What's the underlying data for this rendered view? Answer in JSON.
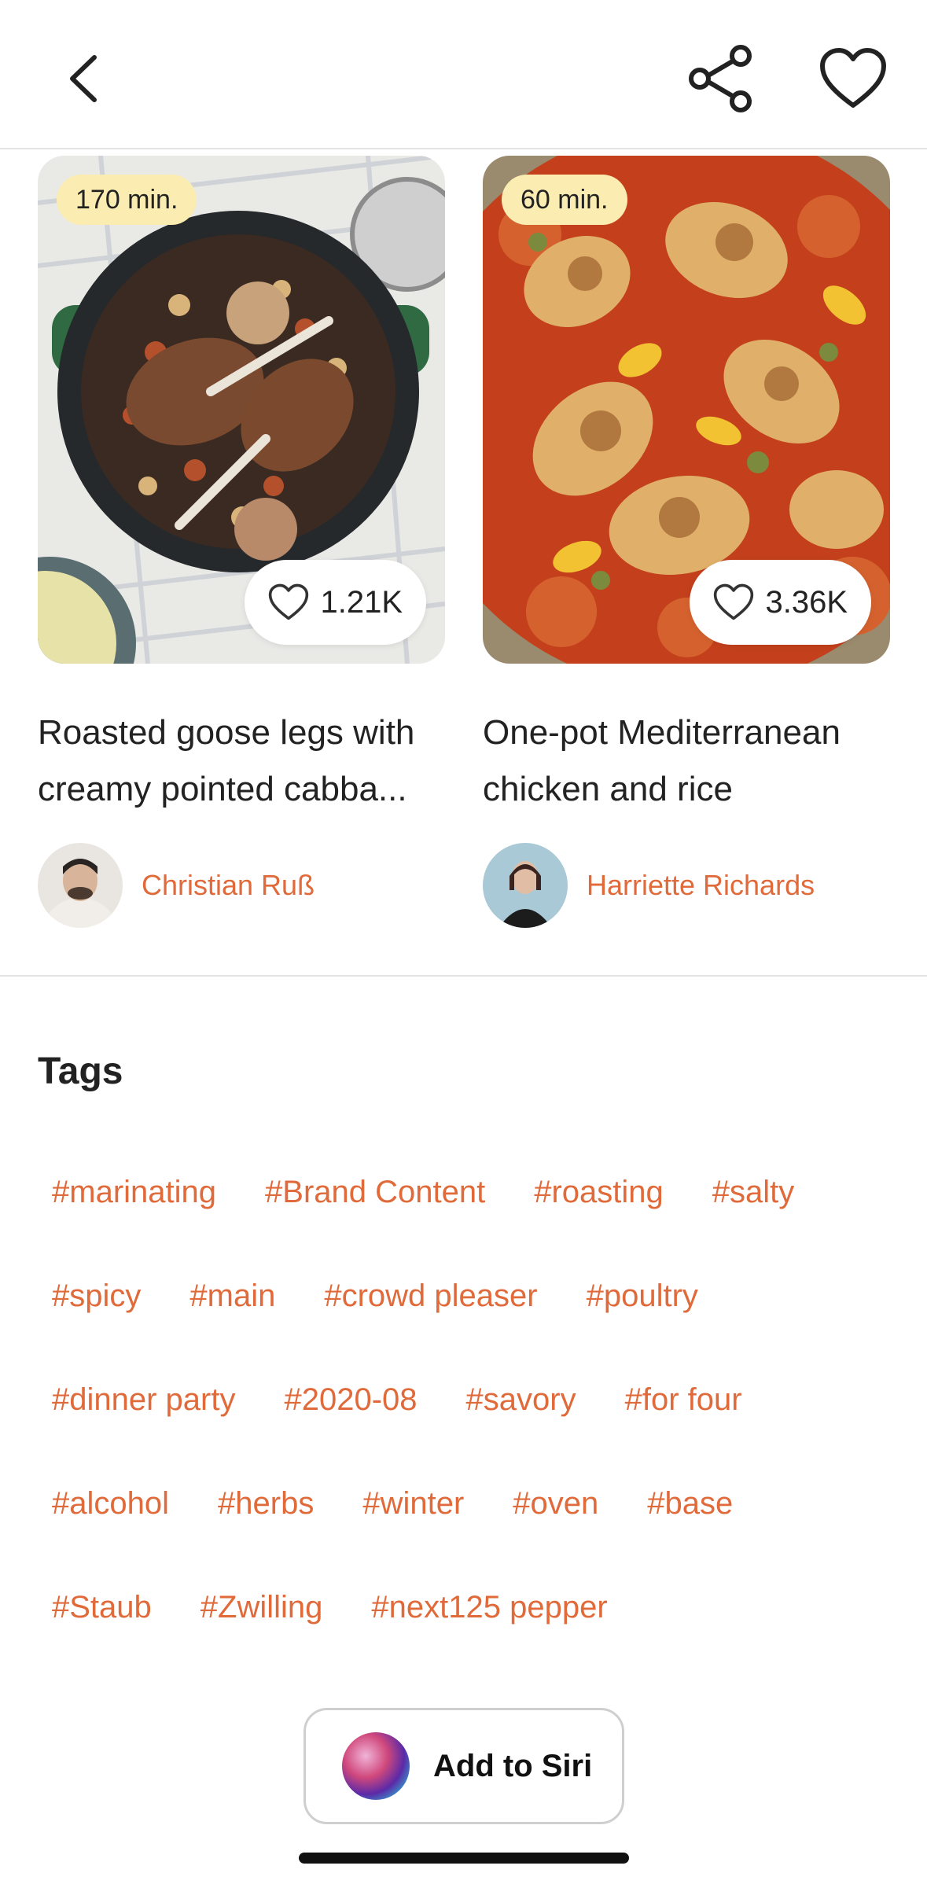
{
  "header": {
    "back_icon": "chevron-left-icon",
    "share_icon": "share-icon",
    "favorite_icon": "heart-outline-icon"
  },
  "recipes": [
    {
      "time": "170 min.",
      "likes": "1.21K",
      "title": "Roasted goose legs with creamy pointed cabba...",
      "author": "Christian Ruß"
    },
    {
      "time": "60 min.",
      "likes": "3.36K",
      "title": "One-pot Mediterranean chicken and rice",
      "author": "Harriette Richards"
    }
  ],
  "tags": {
    "title": "Tags",
    "items": [
      "#marinating",
      "#Brand Content",
      "#roasting",
      "#salty",
      "#spicy",
      "#main",
      "#crowd pleaser",
      "#poultry",
      "#dinner party",
      "#2020-08",
      "#savory",
      "#for four",
      "#alcohol",
      "#herbs",
      "#winter",
      "#oven",
      "#base",
      "#Staub",
      "#Zwilling",
      "#next125 pepper"
    ]
  },
  "siri": {
    "label": "Add to Siri"
  },
  "colors": {
    "accent": "#e06a3a",
    "time_pill": "#fbecb1",
    "divider": "#e3e3e3"
  }
}
